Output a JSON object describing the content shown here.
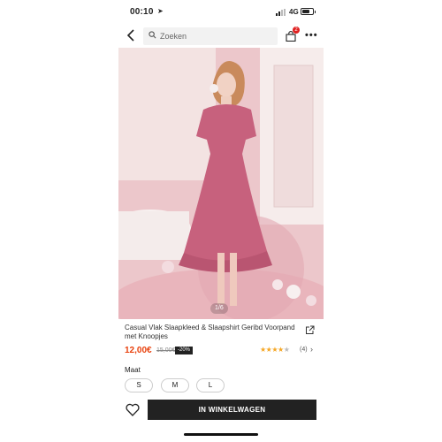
{
  "status_bar": {
    "time": "00:10",
    "network": "4G",
    "location_icon": "location-arrow-icon",
    "signal_icon": "cellular-signal-icon",
    "battery_icon": "battery-icon"
  },
  "nav": {
    "back_icon": "chevron-left-icon",
    "search_placeholder": "Zoeken",
    "search_icon": "search-icon",
    "bag_icon": "shopping-bag-icon",
    "bag_badge": "2",
    "more_icon": "more-horizontal-icon"
  },
  "product": {
    "image_counter": "1/6",
    "title": "Casual Vlak Slaapkleed & Slaapshirt Geribd Voorpand met Knoopjes",
    "share_icon": "share-icon",
    "price": "12,00€",
    "old_price": "15,00€",
    "discount": "-20%",
    "rating": 4,
    "rating_max": 5,
    "review_count": "(4)",
    "review_chevron": "›"
  },
  "size": {
    "label": "Maat",
    "options": [
      "S",
      "M",
      "L"
    ]
  },
  "actions": {
    "wishlist_icon": "heart-outline-icon",
    "add_to_bag_label": "IN WINKELWAGEN"
  },
  "colors": {
    "price": "#e8400c",
    "button": "#222222",
    "badge": "#e02020",
    "star": "#f5a623"
  }
}
